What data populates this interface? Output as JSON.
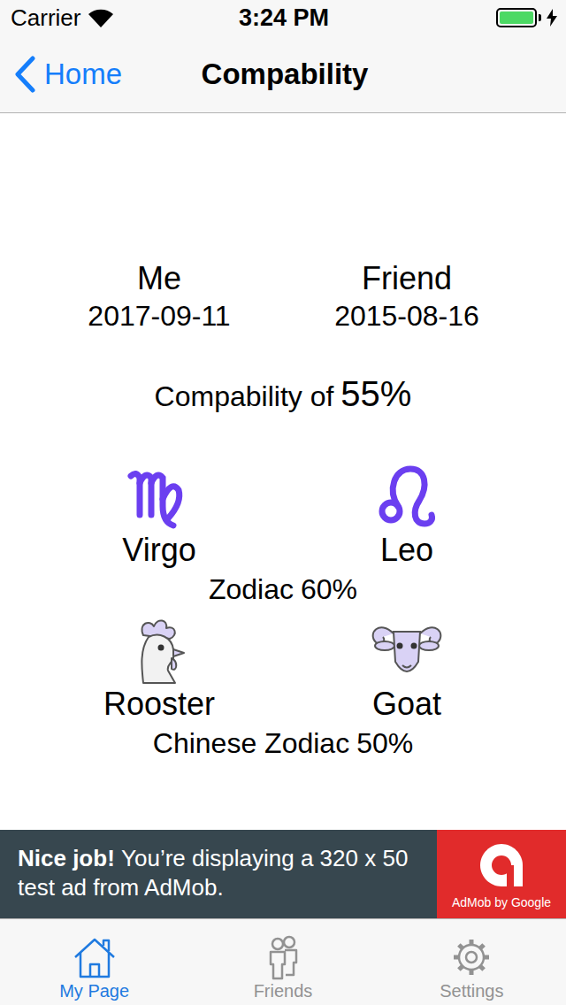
{
  "status_bar": {
    "carrier": "Carrier",
    "time": "3:24 PM",
    "battery": {
      "level": 1,
      "charging": true
    }
  },
  "nav_bar": {
    "back": "Home",
    "title": "Compability"
  },
  "people": [
    {
      "label": "Me",
      "date": "2017-09-11"
    },
    {
      "label": "Friend",
      "date": "2015-08-16"
    }
  ],
  "overall": {
    "label": "Compability of",
    "value": "55%"
  },
  "zodiac": {
    "signs": [
      "Virgo",
      "Leo"
    ],
    "label": "Zodiac",
    "value": "60%"
  },
  "chinese_zodiac": {
    "signs": [
      "Rooster",
      "Goat"
    ],
    "label": "Chinese Zodiac",
    "value": "50%"
  },
  "ad": {
    "headline": "Nice job!",
    "text": "You’re displaying a 320 x 50 test ad from AdMob.",
    "brand": "AdMob by Google"
  },
  "tab_bar": [
    {
      "label": "My Page",
      "selected": true
    },
    {
      "label": "Friends",
      "selected": false
    },
    {
      "label": "Settings",
      "selected": false
    }
  ]
}
